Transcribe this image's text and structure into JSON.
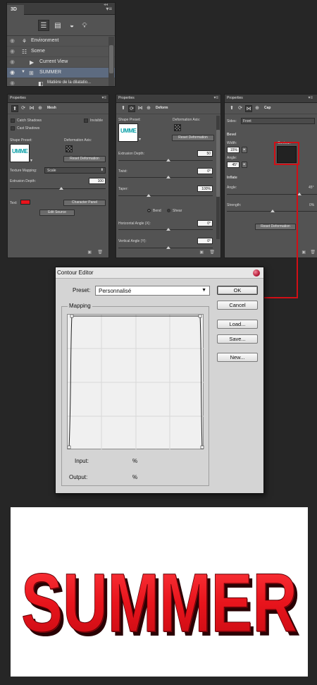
{
  "panel3d": {
    "tab": "3D",
    "rows": [
      {
        "label": "Environment",
        "icon": "environment-icon"
      },
      {
        "label": "Scene",
        "icon": "scene-icon"
      },
      {
        "label": "Current View",
        "icon": "camera-icon"
      },
      {
        "label": "SUMMER",
        "icon": "mesh-icon"
      },
      {
        "label": "Matière de la dilatatio...",
        "icon": "material-icon"
      }
    ]
  },
  "mesh_panel": {
    "tab": "Properties",
    "title": "Mesh",
    "catch_shadows": "Catch Shadows",
    "invisible": "Invisible",
    "cast_shadows": "Cast Shadows",
    "shape_preset": "Shape Preset:",
    "deformation_axis": "Deformation Axis:",
    "reset_deformation": "Reset Deformation",
    "texture_mapping": "Texture Mapping:",
    "texture_mapping_value": "Scale",
    "extrusion_depth": "Extrusion Depth:",
    "extrusion_depth_value": "100",
    "text": "Text:",
    "text_color": "#e8141c",
    "character_panel": "Character Panel",
    "edit_source": "Edit Source",
    "preview_text": "UMME"
  },
  "deform_panel": {
    "tab": "Properties",
    "title": "Deform",
    "shape_preset": "Shape Preset:",
    "deformation_axis": "Deformation Axis:",
    "reset_deformation": "Reset Deformation",
    "extrusion_depth": "Extrusion Depth:",
    "extrusion_depth_value": "50",
    "twist": "Twist:",
    "twist_value": "0°",
    "taper": "Taper:",
    "taper_value": "100%",
    "bend": "Bend",
    "shear": "Shear",
    "horizontal_angle": "Horizontal Angle (X):",
    "horizontal_angle_value": "0°",
    "vertical_angle": "Vertical Angle (Y):",
    "vertical_angle_value": "0°",
    "preview_text": "UMME"
  },
  "cap_panel": {
    "tab": "Properties",
    "title": "Cap",
    "sides": "Sides:",
    "sides_value": "Front",
    "bevel": "Bevel",
    "width": "Width:",
    "width_value": "15%",
    "contour": "Contour:",
    "angle": "Angle:",
    "angle_value": "45°",
    "inflate": "Inflate",
    "inflate_angle": "Angle:",
    "inflate_angle_value": "45°",
    "strength": "Strength:",
    "strength_value": "0%",
    "reset_deformation": "Reset Deformation"
  },
  "contour_editor": {
    "title": "Contour Editor",
    "preset_label": "Preset:",
    "preset_value": "Personnalisé",
    "ok": "OK",
    "cancel": "Cancel",
    "load": "Load...",
    "save": "Save...",
    "new": "New...",
    "mapping": "Mapping",
    "input_label": "Input:",
    "input_unit": "%",
    "output_label": "Output:",
    "output_unit": "%"
  },
  "banner": {
    "text": "SUMMER",
    "color": "#e8141c"
  },
  "colors": {
    "panel_bg": "#535353",
    "selected_row": "#5d6b80",
    "callout": "#d10f16"
  }
}
